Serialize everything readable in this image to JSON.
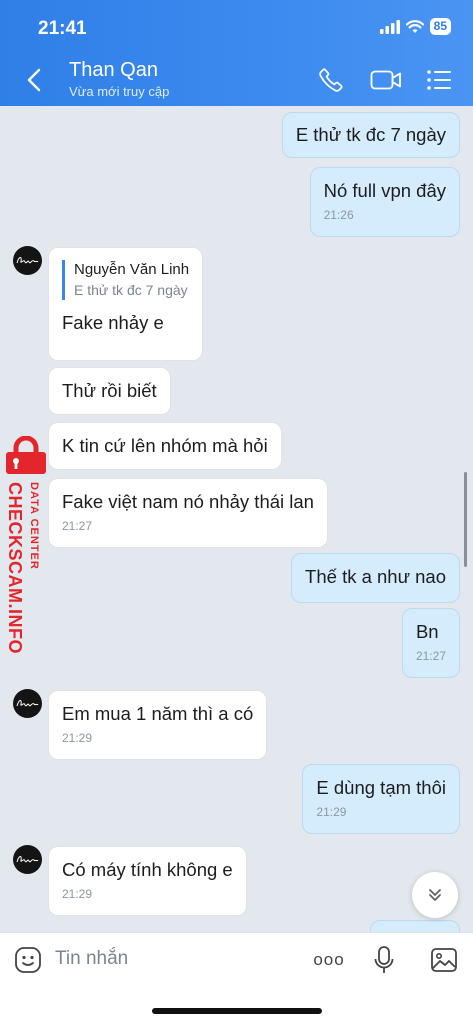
{
  "status": {
    "time": "21:41",
    "battery": "85"
  },
  "header": {
    "title": "Than Qan",
    "subtitle": "Vừa mới truy cập"
  },
  "messages": {
    "m1": {
      "text": "E thử tk đc 7 ngày"
    },
    "m2": {
      "text": "Nó full vpn đây",
      "time": "21:26"
    },
    "m3": {
      "quote_name": "Nguyễn Văn Linh",
      "quote_text": "E thử tk đc 7 ngày",
      "text": "Fake nhảy e"
    },
    "m4": {
      "text": "Thử rồi biết"
    },
    "m5": {
      "text": "K tin cứ lên nhóm mà hỏi"
    },
    "m6": {
      "text": "Fake việt nam nó nhảy thái lan",
      "time": "21:27"
    },
    "m7": {
      "text": "Thế tk a như nao"
    },
    "m8": {
      "text": "Bn",
      "time": "21:27"
    },
    "m9": {
      "text": "Em mua 1 năm thì a có",
      "time": "21:29"
    },
    "m10": {
      "text": "E dùng tạm thôi",
      "time": "21:29"
    },
    "m11": {
      "text": "Có máy tính không e",
      "time": "21:29"
    }
  },
  "watermark": {
    "small": "DATA CENTER",
    "big": "CHECKSCAM.INFO"
  },
  "composer": {
    "placeholder": "Tin nhắn",
    "more_label": "ooo"
  },
  "colors": {
    "header": "#3d8bf0",
    "outgoing": "#d5ecfd",
    "incoming": "#ffffff",
    "background": "#e3e8ee",
    "watermark": "#e3262b"
  }
}
